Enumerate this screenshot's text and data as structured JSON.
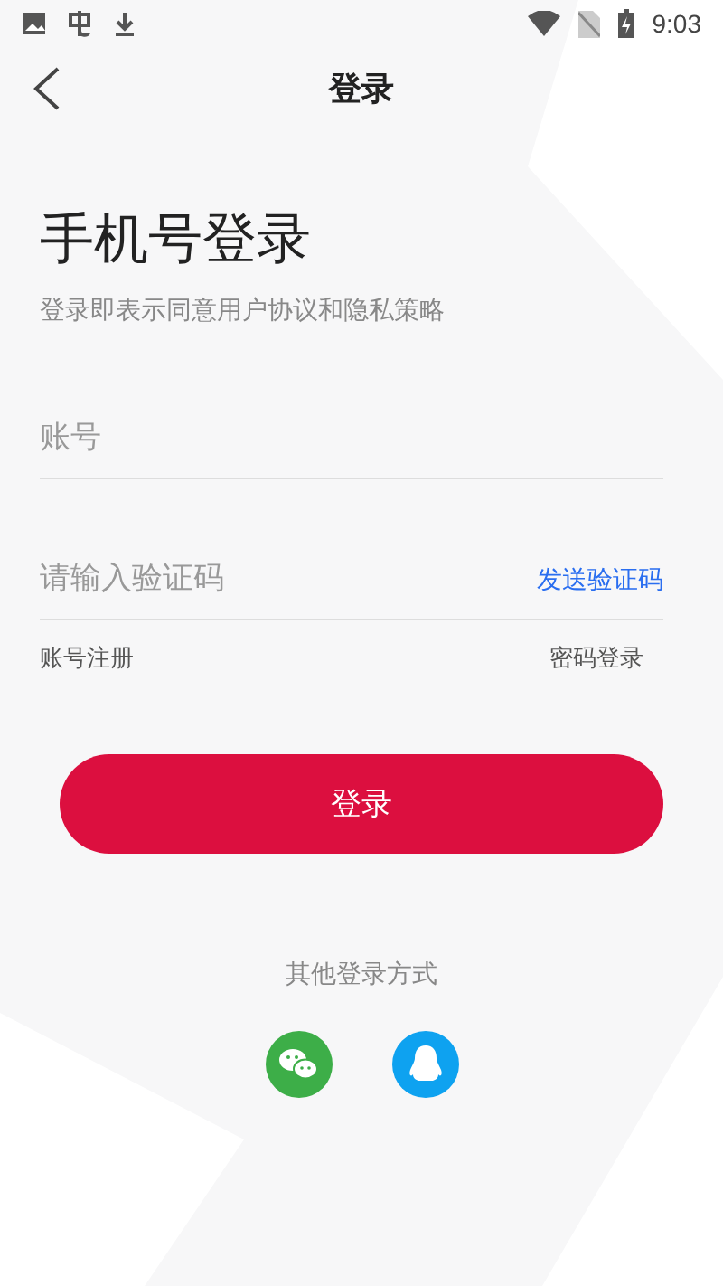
{
  "status_bar": {
    "time": "9:03"
  },
  "header": {
    "title": "登录"
  },
  "heading": "手机号登录",
  "subtitle": "登录即表示同意用户协议和隐私策略",
  "fields": [
    {
      "placeholder": "账号"
    },
    {
      "placeholder": "请输入验证码",
      "action": "发送验证码"
    }
  ],
  "links": [
    "账号注册",
    "密码登录"
  ],
  "login_button": "登录",
  "other_login": {
    "label": "其他登录方式",
    "options": [
      {
        "kind": "wechat"
      },
      {
        "kind": "qq"
      }
    ]
  }
}
